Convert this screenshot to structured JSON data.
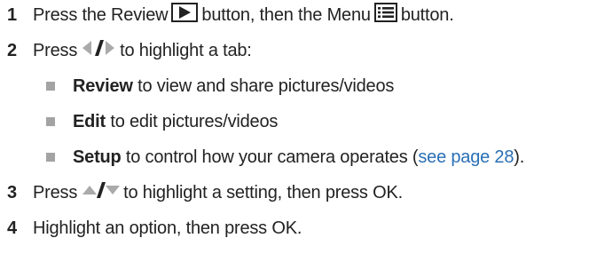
{
  "steps": [
    {
      "number": "1",
      "before": "Press the Review",
      "middle": "button, then the Menu",
      "after": "button."
    },
    {
      "number": "2",
      "before": "Press",
      "after": "to highlight a tab:"
    },
    {
      "number": "3",
      "before": "Press",
      "after": "to highlight a setting, then press OK."
    },
    {
      "number": "4",
      "text": "Highlight an option, then press OK."
    }
  ],
  "tabs": [
    {
      "name": "Review",
      "desc": "to view and share pictures/videos"
    },
    {
      "name": "Edit",
      "desc": "to edit pictures/videos"
    },
    {
      "name": "Setup",
      "desc": "to control how your camera operates (",
      "link": "see page 28",
      "desc_end": ")."
    }
  ],
  "icons": {
    "review": "review-play-button-icon",
    "menu": "menu-button-icon",
    "left_right": "left-right-arrows-icon",
    "up_down": "up-down-arrows-icon"
  },
  "colors": {
    "bullet": "#a3a3a3",
    "link": "#2a6fb5",
    "text": "#222222"
  }
}
